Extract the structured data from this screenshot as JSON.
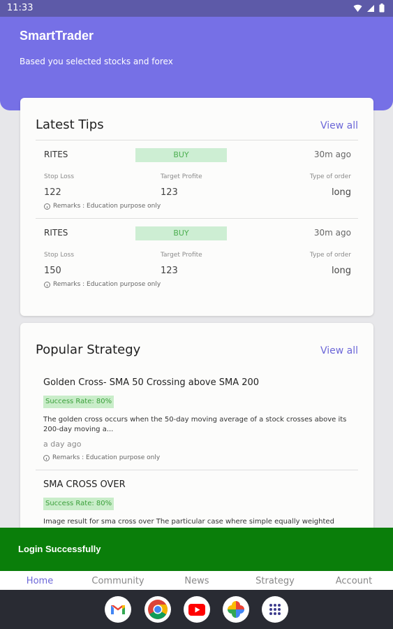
{
  "status_bar": {
    "time": "11:33"
  },
  "header": {
    "title": "SmartTrader",
    "subtitle": "Based you selected stocks and forex"
  },
  "latest_tips": {
    "title": "Latest Tips",
    "view_all": "View all",
    "items": [
      {
        "symbol": "RITES",
        "action": "BUY",
        "time": "30m ago",
        "stop_loss_label": "Stop Loss",
        "stop_loss": "122",
        "target_label": "Target Profite",
        "target": "123",
        "order_label": "Type of order",
        "order": "long",
        "remarks": "Remarks : Education purpose only"
      },
      {
        "symbol": "RITES",
        "action": "BUY",
        "time": "30m ago",
        "stop_loss_label": "Stop Loss",
        "stop_loss": "150",
        "target_label": "Target Profite",
        "target": "123",
        "order_label": "Type of order",
        "order": "long",
        "remarks": "Remarks : Education purpose only"
      }
    ]
  },
  "popular_strategy": {
    "title": "Popular Strategy",
    "view_all": "View all",
    "items": [
      {
        "title": "Golden Cross- SMA 50 Crossing above SMA 200",
        "success_rate": "Success Rate: 80%",
        "description": "The golden cross occurs when the 50-day moving average of a stock crosses above its 200-day moving a...",
        "time": "a day ago",
        "remarks": "Remarks : Education purpose only"
      },
      {
        "title": "SMA CROSS OVER",
        "success_rate": "Success Rate: 80%",
        "description": "Image result for sma cross over The particular case where simple equally weighted"
      }
    ]
  },
  "snackbar": {
    "message": "Login Successfully"
  },
  "nav": {
    "items": [
      {
        "label": "Home",
        "active": true
      },
      {
        "label": "Community"
      },
      {
        "label": "News"
      },
      {
        "label": "Strategy"
      },
      {
        "label": "Account"
      }
    ]
  },
  "dock": {
    "apps": [
      "gmail-icon",
      "chrome-icon",
      "youtube-icon",
      "photos-icon",
      "app-drawer-icon"
    ]
  },
  "colors": {
    "primary": "#7670e6",
    "accent": "#6c67d8",
    "buy_badge": "#cdeed3",
    "snackbar": "#0a7e0a"
  }
}
